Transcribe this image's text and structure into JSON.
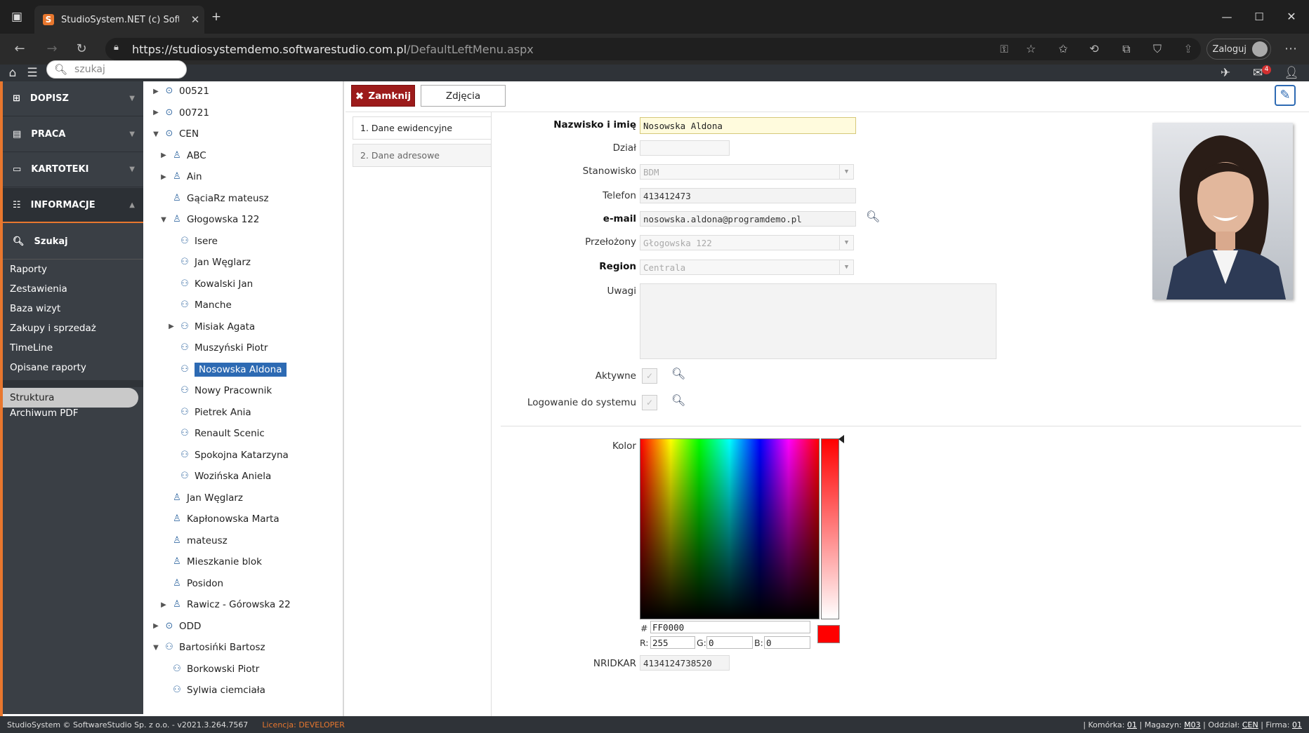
{
  "browser": {
    "tab_title": "StudioSystem.NET (c) SoftwareSt",
    "url_host": "https://studiosystemdemo.softwarestudio.com.pl",
    "url_path": "/DefaultLeftMenu.aspx",
    "login_label": "Zaloguj"
  },
  "topbar": {
    "search_placeholder": "szukaj",
    "mail_count": "4"
  },
  "menu": {
    "sections": [
      {
        "label": "DOPISZ",
        "icon": "plus-square-icon"
      },
      {
        "label": "PRACA",
        "icon": "document-icon"
      },
      {
        "label": "KARTOTEKI",
        "icon": "folder-icon"
      },
      {
        "label": "INFORMACJE",
        "icon": "sitemap-icon"
      }
    ],
    "search_label": "Szukaj",
    "links": [
      "Raporty",
      "Zestawienia",
      "Baza wizyt",
      "Zakupy i sprzedaż",
      "TimeLine",
      "Opisane raporty"
    ],
    "struktura": "Struktura",
    "archiwum": "Archiwum PDF"
  },
  "tree": {
    "nodes": [
      {
        "label": "00521",
        "level": 0,
        "expander": "collapsed",
        "icon": "clock-icon"
      },
      {
        "label": "00721",
        "level": 0,
        "expander": "collapsed",
        "icon": "clock-icon"
      },
      {
        "label": "CEN",
        "level": 0,
        "expander": "expanded",
        "icon": "clock-icon"
      },
      {
        "label": "ABC",
        "level": 1,
        "expander": "collapsed",
        "icon": "building-icon"
      },
      {
        "label": "Ain",
        "level": 1,
        "expander": "collapsed",
        "icon": "building-icon"
      },
      {
        "label": "GąciaRz mateusz",
        "level": 1,
        "expander": "none",
        "icon": "building-icon"
      },
      {
        "label": "Głogowska 122",
        "level": 1,
        "expander": "expanded",
        "icon": "building-icon"
      },
      {
        "label": "Isere",
        "level": 2,
        "expander": "none",
        "icon": "person-icon"
      },
      {
        "label": "Jan Węglarz",
        "level": 2,
        "expander": "none",
        "icon": "person-icon"
      },
      {
        "label": "Kowalski Jan",
        "level": 2,
        "expander": "none",
        "icon": "person-icon"
      },
      {
        "label": "Manche",
        "level": 2,
        "expander": "none",
        "icon": "person-icon"
      },
      {
        "label": "Misiak Agata",
        "level": 2,
        "expander": "collapsed",
        "icon": "person-icon"
      },
      {
        "label": "Muszyński Piotr",
        "level": 2,
        "expander": "none",
        "icon": "person-icon"
      },
      {
        "label": "Nosowska Aldona",
        "level": 2,
        "expander": "none",
        "icon": "person-icon",
        "selected": true
      },
      {
        "label": "Nowy Pracownik",
        "level": 2,
        "expander": "none",
        "icon": "person-icon"
      },
      {
        "label": "Pietrek Ania",
        "level": 2,
        "expander": "none",
        "icon": "person-icon"
      },
      {
        "label": "Renault Scenic",
        "level": 2,
        "expander": "none",
        "icon": "person-icon"
      },
      {
        "label": "Spokojna Katarzyna",
        "level": 2,
        "expander": "none",
        "icon": "person-icon"
      },
      {
        "label": "Wozińska Aniela",
        "level": 2,
        "expander": "none",
        "icon": "person-icon"
      },
      {
        "label": "Jan Węglarz",
        "level": 1,
        "expander": "none",
        "icon": "building-icon"
      },
      {
        "label": "Kapłonowska Marta",
        "level": 1,
        "expander": "none",
        "icon": "building-icon"
      },
      {
        "label": "mateusz",
        "level": 1,
        "expander": "none",
        "icon": "building-icon"
      },
      {
        "label": "Mieszkanie blok",
        "level": 1,
        "expander": "none",
        "icon": "building-icon"
      },
      {
        "label": "Posidon",
        "level": 1,
        "expander": "none",
        "icon": "building-icon"
      },
      {
        "label": "Rawicz - Górowska 22",
        "level": 1,
        "expander": "collapsed",
        "icon": "building-icon"
      },
      {
        "label": "ODD",
        "level": 0,
        "expander": "collapsed",
        "icon": "clock-icon"
      },
      {
        "label": "Bartosińki Bartosz",
        "level": 0,
        "expander": "expanded",
        "icon": "person-icon"
      },
      {
        "label": "Borkowski Piotr",
        "level": 1,
        "expander": "none",
        "icon": "person-icon"
      },
      {
        "label": "Sylwia ciemciała",
        "level": 1,
        "expander": "none",
        "icon": "person-icon"
      }
    ]
  },
  "toolbar": {
    "close_label": "Zamknij",
    "photos_label": "Zdjęcia"
  },
  "tabs": [
    "1. Dane ewidencyjne",
    "2. Dane adresowe"
  ],
  "form": {
    "name_label": "Nazwisko i imię",
    "name_value": "Nosowska Aldona",
    "dept_label": "Dział",
    "dept_value": "",
    "position_label": "Stanowisko",
    "position_value": "BDM",
    "phone_label": "Telefon",
    "phone_value": "413412473",
    "email_label": "e-mail",
    "email_value": "nosowska.aldona@programdemo.pl",
    "supervisor_label": "Przełożony",
    "supervisor_value": "Głogowska 122",
    "region_label": "Region",
    "region_value": "Centrala",
    "notes_label": "Uwagi",
    "notes_value": "",
    "active_label": "Aktywne",
    "login_label": "Logowanie do systemu",
    "color_label": "Kolor",
    "hex_prefix": "#",
    "hex_value": "FF0000",
    "r_label": "R:",
    "r_value": "255",
    "g_label": "G:",
    "g_value": "0",
    "b_label": "B:",
    "b_value": "0",
    "nridkar_label": "NRIDKAR",
    "nridkar_value": "4134124738520",
    "color_hex": "#ff0000"
  },
  "status": {
    "left": "StudioSystem © SoftwareStudio Sp. z o.o. - v2021.3.264.7567",
    "licence_label": "Licencja: DEVELOPER",
    "right_prefix1": "| Komórka: ",
    "komorka": "01",
    "right_prefix2": " | Magazyn: ",
    "magazyn": "M03",
    "right_prefix3": " | Oddział: ",
    "oddzial": "CEN",
    "right_prefix4": " | Firma: ",
    "firma": "01"
  }
}
